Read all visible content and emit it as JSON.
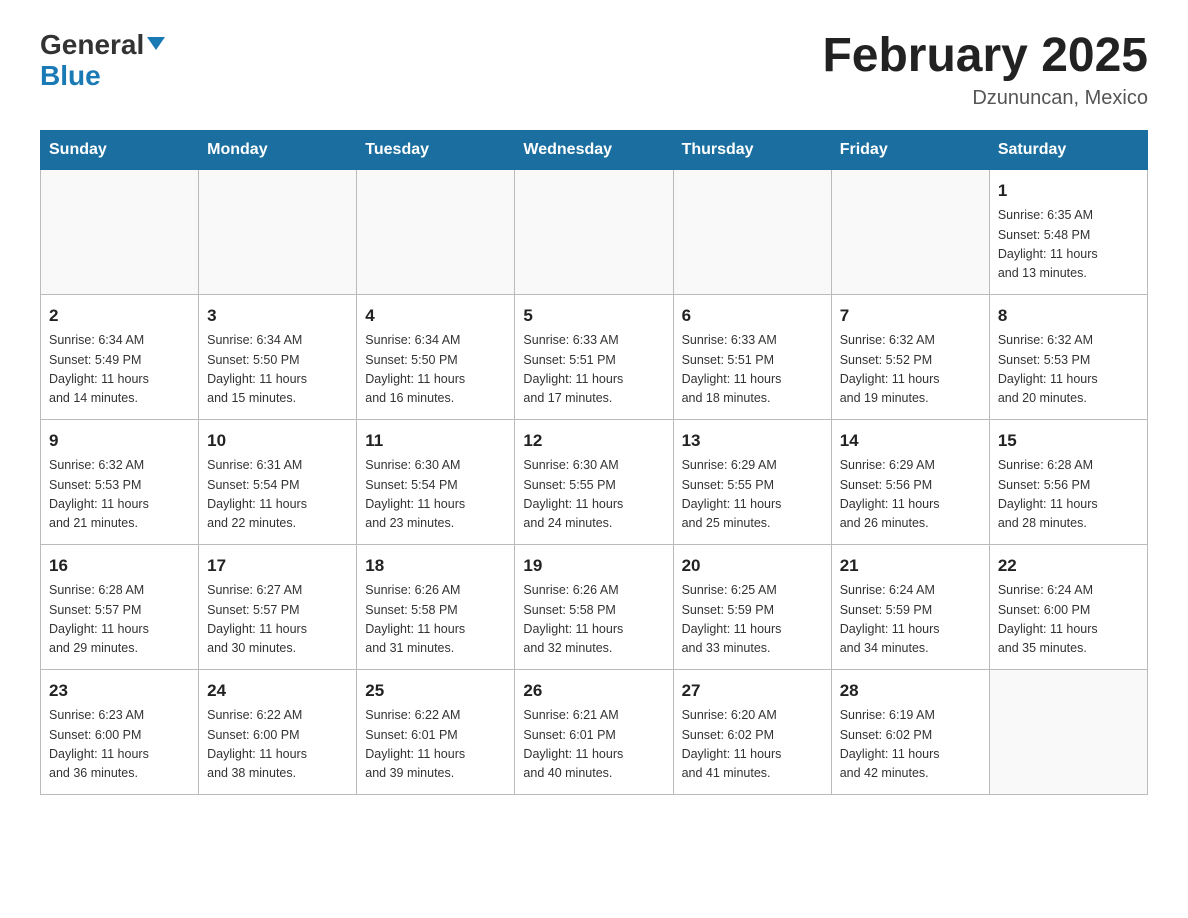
{
  "header": {
    "logo_general": "General",
    "logo_blue": "Blue",
    "month_title": "February 2025",
    "location": "Dzununcan, Mexico"
  },
  "weekdays": [
    "Sunday",
    "Monday",
    "Tuesday",
    "Wednesday",
    "Thursday",
    "Friday",
    "Saturday"
  ],
  "weeks": [
    [
      {
        "day": "",
        "info": ""
      },
      {
        "day": "",
        "info": ""
      },
      {
        "day": "",
        "info": ""
      },
      {
        "day": "",
        "info": ""
      },
      {
        "day": "",
        "info": ""
      },
      {
        "day": "",
        "info": ""
      },
      {
        "day": "1",
        "info": "Sunrise: 6:35 AM\nSunset: 5:48 PM\nDaylight: 11 hours\nand 13 minutes."
      }
    ],
    [
      {
        "day": "2",
        "info": "Sunrise: 6:34 AM\nSunset: 5:49 PM\nDaylight: 11 hours\nand 14 minutes."
      },
      {
        "day": "3",
        "info": "Sunrise: 6:34 AM\nSunset: 5:50 PM\nDaylight: 11 hours\nand 15 minutes."
      },
      {
        "day": "4",
        "info": "Sunrise: 6:34 AM\nSunset: 5:50 PM\nDaylight: 11 hours\nand 16 minutes."
      },
      {
        "day": "5",
        "info": "Sunrise: 6:33 AM\nSunset: 5:51 PM\nDaylight: 11 hours\nand 17 minutes."
      },
      {
        "day": "6",
        "info": "Sunrise: 6:33 AM\nSunset: 5:51 PM\nDaylight: 11 hours\nand 18 minutes."
      },
      {
        "day": "7",
        "info": "Sunrise: 6:32 AM\nSunset: 5:52 PM\nDaylight: 11 hours\nand 19 minutes."
      },
      {
        "day": "8",
        "info": "Sunrise: 6:32 AM\nSunset: 5:53 PM\nDaylight: 11 hours\nand 20 minutes."
      }
    ],
    [
      {
        "day": "9",
        "info": "Sunrise: 6:32 AM\nSunset: 5:53 PM\nDaylight: 11 hours\nand 21 minutes."
      },
      {
        "day": "10",
        "info": "Sunrise: 6:31 AM\nSunset: 5:54 PM\nDaylight: 11 hours\nand 22 minutes."
      },
      {
        "day": "11",
        "info": "Sunrise: 6:30 AM\nSunset: 5:54 PM\nDaylight: 11 hours\nand 23 minutes."
      },
      {
        "day": "12",
        "info": "Sunrise: 6:30 AM\nSunset: 5:55 PM\nDaylight: 11 hours\nand 24 minutes."
      },
      {
        "day": "13",
        "info": "Sunrise: 6:29 AM\nSunset: 5:55 PM\nDaylight: 11 hours\nand 25 minutes."
      },
      {
        "day": "14",
        "info": "Sunrise: 6:29 AM\nSunset: 5:56 PM\nDaylight: 11 hours\nand 26 minutes."
      },
      {
        "day": "15",
        "info": "Sunrise: 6:28 AM\nSunset: 5:56 PM\nDaylight: 11 hours\nand 28 minutes."
      }
    ],
    [
      {
        "day": "16",
        "info": "Sunrise: 6:28 AM\nSunset: 5:57 PM\nDaylight: 11 hours\nand 29 minutes."
      },
      {
        "day": "17",
        "info": "Sunrise: 6:27 AM\nSunset: 5:57 PM\nDaylight: 11 hours\nand 30 minutes."
      },
      {
        "day": "18",
        "info": "Sunrise: 6:26 AM\nSunset: 5:58 PM\nDaylight: 11 hours\nand 31 minutes."
      },
      {
        "day": "19",
        "info": "Sunrise: 6:26 AM\nSunset: 5:58 PM\nDaylight: 11 hours\nand 32 minutes."
      },
      {
        "day": "20",
        "info": "Sunrise: 6:25 AM\nSunset: 5:59 PM\nDaylight: 11 hours\nand 33 minutes."
      },
      {
        "day": "21",
        "info": "Sunrise: 6:24 AM\nSunset: 5:59 PM\nDaylight: 11 hours\nand 34 minutes."
      },
      {
        "day": "22",
        "info": "Sunrise: 6:24 AM\nSunset: 6:00 PM\nDaylight: 11 hours\nand 35 minutes."
      }
    ],
    [
      {
        "day": "23",
        "info": "Sunrise: 6:23 AM\nSunset: 6:00 PM\nDaylight: 11 hours\nand 36 minutes."
      },
      {
        "day": "24",
        "info": "Sunrise: 6:22 AM\nSunset: 6:00 PM\nDaylight: 11 hours\nand 38 minutes."
      },
      {
        "day": "25",
        "info": "Sunrise: 6:22 AM\nSunset: 6:01 PM\nDaylight: 11 hours\nand 39 minutes."
      },
      {
        "day": "26",
        "info": "Sunrise: 6:21 AM\nSunset: 6:01 PM\nDaylight: 11 hours\nand 40 minutes."
      },
      {
        "day": "27",
        "info": "Sunrise: 6:20 AM\nSunset: 6:02 PM\nDaylight: 11 hours\nand 41 minutes."
      },
      {
        "day": "28",
        "info": "Sunrise: 6:19 AM\nSunset: 6:02 PM\nDaylight: 11 hours\nand 42 minutes."
      },
      {
        "day": "",
        "info": ""
      }
    ]
  ]
}
